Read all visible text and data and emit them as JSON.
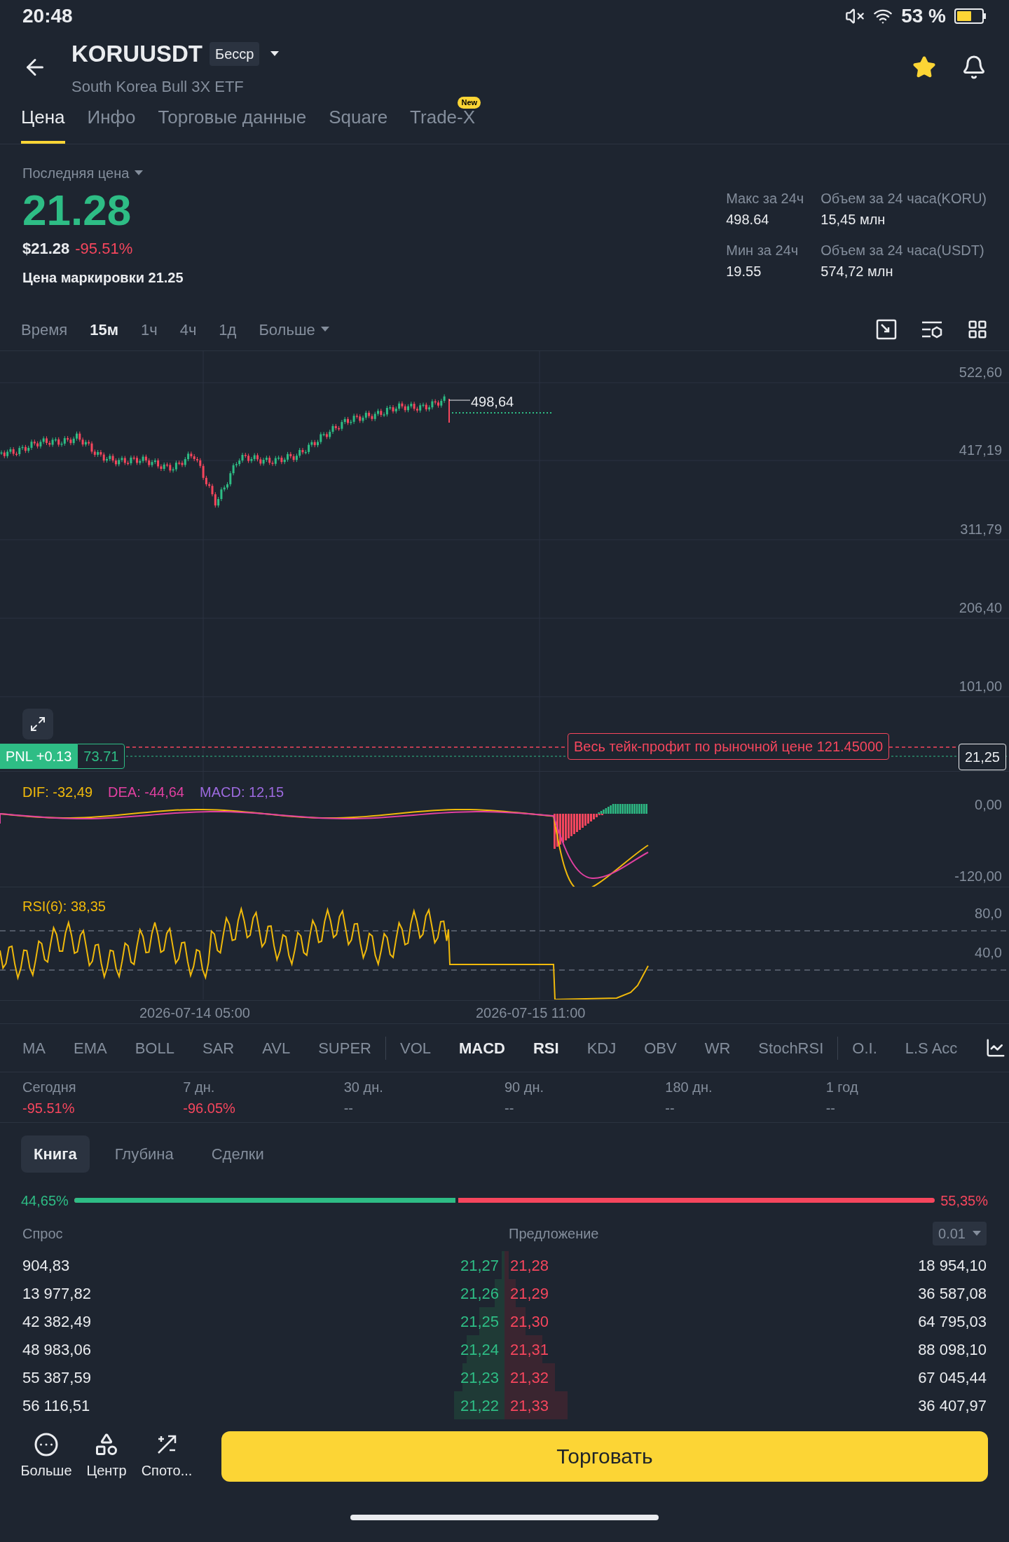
{
  "status_bar": {
    "time": "20:48",
    "battery": "53 %"
  },
  "header": {
    "symbol": "KORUUSDT",
    "badge": "Бесср",
    "subtitle": "South Korea Bull 3X ETF",
    "favorite": true
  },
  "tabs": [
    {
      "label": "Цена",
      "selected": true
    },
    {
      "label": "Инфо",
      "selected": false
    },
    {
      "label": "Торговые данные",
      "selected": false
    },
    {
      "label": "Square",
      "selected": false
    },
    {
      "label": "Trade-X",
      "selected": false,
      "badge": "New"
    }
  ],
  "price": {
    "label": "Последняя цена",
    "last": "21.28",
    "usd": "$21.28",
    "change": "-95.51%",
    "mark": "Цена маркировки 21.25"
  },
  "stats": [
    {
      "label": "Макс за 24ч",
      "value": "498.64"
    },
    {
      "label": "Объем за 24 часа(KORU)",
      "value": "15,45 млн"
    },
    {
      "label": "Мин за 24ч",
      "value": "19.55"
    },
    {
      "label": "Объем за 24 часа(USDT)",
      "value": "574,72 млн"
    }
  ],
  "intervals": [
    {
      "label": "Время",
      "selected": false
    },
    {
      "label": "15м",
      "selected": true
    },
    {
      "label": "1ч",
      "selected": false
    },
    {
      "label": "4ч",
      "selected": false
    },
    {
      "label": "1д",
      "selected": false
    }
  ],
  "more_intervals": "Больше",
  "chart": {
    "y_labels": [
      "522,60",
      "417,19",
      "311,79",
      "206,40",
      "101,00"
    ],
    "high_label": "498,64",
    "pnl_label": "PNL +0.13",
    "pnl_value": "73.71",
    "take_profit": "Весь тейк-профит по рыночной цене 121.45000",
    "current_price": "21,25"
  },
  "macd": {
    "dif": "DIF: -32,49",
    "dea": "DEA: -44,64",
    "macd": "MACD: 12,15",
    "y_labels": [
      "0,00",
      "-120,00"
    ]
  },
  "rsi": {
    "label": "RSI(6): 38,35",
    "y_labels": [
      "80,0",
      "40,0"
    ]
  },
  "x_labels": [
    "2026-07-14 05:00",
    "2026-07-15 11:00"
  ],
  "indicator_groups": [
    [
      {
        "label": "MA",
        "selected": false
      },
      {
        "label": "EMA",
        "selected": false
      },
      {
        "label": "BOLL",
        "selected": false
      },
      {
        "label": "SAR",
        "selected": false
      },
      {
        "label": "AVL",
        "selected": false
      },
      {
        "label": "SUPER",
        "selected": false
      }
    ],
    [
      {
        "label": "VOL",
        "selected": false
      },
      {
        "label": "MACD",
        "selected": true
      },
      {
        "label": "RSI",
        "selected": true
      },
      {
        "label": "KDJ",
        "selected": false
      },
      {
        "label": "OBV",
        "selected": false
      },
      {
        "label": "WR",
        "selected": false
      },
      {
        "label": "StochRSI",
        "selected": false
      }
    ],
    [
      {
        "label": "O.I.",
        "selected": false
      },
      {
        "label": "L.S Acc",
        "selected": false
      }
    ]
  ],
  "periods": [
    {
      "label": "Сегодня",
      "value": "-95.51%",
      "color": "#f6465d"
    },
    {
      "label": "7 дн.",
      "value": "-96.05%",
      "color": "#f6465d"
    },
    {
      "label": "30 дн.",
      "value": "--",
      "color": "#848e9c"
    },
    {
      "label": "90 дн.",
      "value": "--",
      "color": "#848e9c"
    },
    {
      "label": "180 дн.",
      "value": "--",
      "color": "#848e9c"
    },
    {
      "label": "1 год",
      "value": "--",
      "color": "#848e9c"
    }
  ],
  "book_tabs": [
    {
      "label": "Книга",
      "selected": true
    },
    {
      "label": "Глубина",
      "selected": false
    },
    {
      "label": "Сделки",
      "selected": false
    }
  ],
  "ratio": {
    "bid": "44,65%",
    "ask": "55,35%",
    "level": 0.4465
  },
  "book": {
    "bid_header": "Спрос",
    "ask_header": "Предложение",
    "precision": "0.01",
    "rows": [
      {
        "bid": {
          "qty": "904,83",
          "price": "21,27"
        },
        "ask": {
          "price": "21,28",
          "qty": "18 954,10"
        }
      },
      {
        "bid": {
          "qty": "13 977,82",
          "price": "21,26"
        },
        "ask": {
          "price": "21,29",
          "qty": "36 587,08"
        }
      },
      {
        "bid": {
          "qty": "42 382,49",
          "price": "21,25"
        },
        "ask": {
          "price": "21,30",
          "qty": "64 795,03"
        }
      },
      {
        "bid": {
          "qty": "48 983,06",
          "price": "21,24"
        },
        "ask": {
          "price": "21,31",
          "qty": "88 098,10"
        }
      },
      {
        "bid": {
          "qty": "55 387,59",
          "price": "21,23"
        },
        "ask": {
          "price": "21,32",
          "qty": "67 045,44"
        }
      },
      {
        "bid": {
          "qty": "56 116,51",
          "price": "21,22"
        },
        "ask": {
          "price": "21,33",
          "qty": "36 407,97"
        }
      }
    ]
  },
  "bottom_bar": {
    "actions": [
      {
        "label": "Больше",
        "kind": "more"
      },
      {
        "label": "Центр",
        "kind": "hub"
      },
      {
        "label": "Спото...",
        "kind": "spot"
      }
    ],
    "trade_button": "Торговать"
  }
}
